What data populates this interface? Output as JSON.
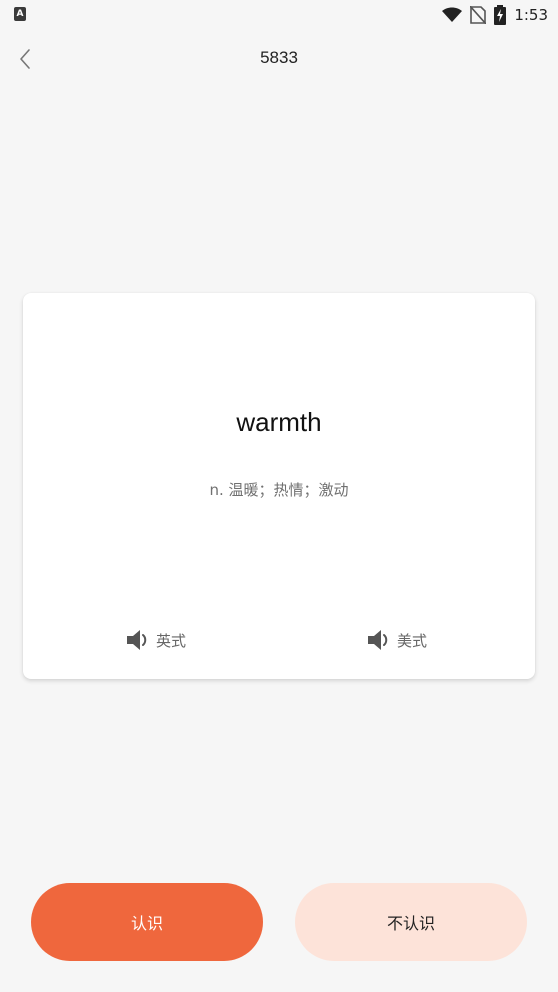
{
  "status_bar": {
    "left_icon_letter": "A",
    "time": "1:53",
    "icons": [
      "wifi-icon",
      "no-sim-icon",
      "battery-charging-icon"
    ]
  },
  "header": {
    "title": "5833",
    "back_icon": "chevron-left-icon"
  },
  "card": {
    "word": "warmth",
    "meaning": "n. 温暖；热情；激动",
    "pronunciations": [
      {
        "label": "英式",
        "icon": "speaker-icon"
      },
      {
        "label": "美式",
        "icon": "speaker-icon"
      }
    ]
  },
  "actions": {
    "know_label": "认识",
    "unknown_label": "不认识"
  },
  "colors": {
    "accent": "#ef673d",
    "accent_light": "#fde3d9",
    "background": "#f6f6f6"
  }
}
